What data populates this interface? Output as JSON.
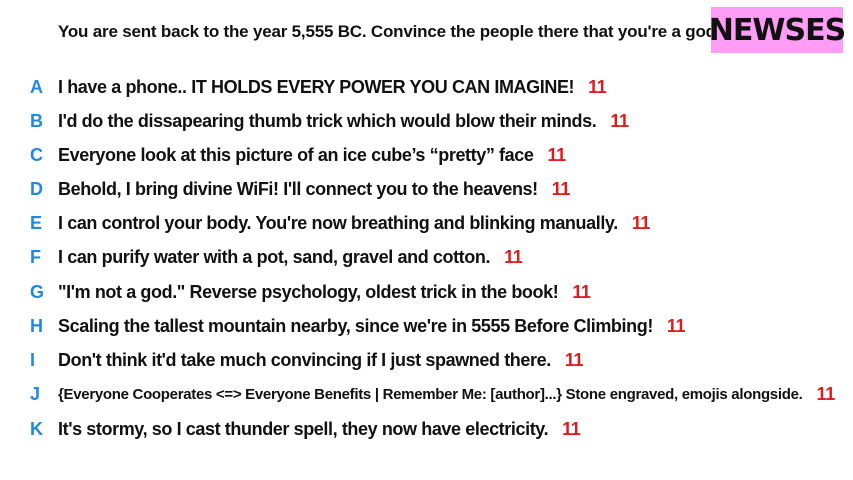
{
  "prompt": "You are sent back to the year 5,555 BC. Convince the people there that you're a god.",
  "brand": "NEWSES",
  "colors": {
    "letter": "#1f88e5",
    "votes": "#e01b1b",
    "brand_bg": "#ff9cf5"
  },
  "answers": [
    {
      "letter": "A",
      "text": "I have a phone.. IT HOLDS EVERY POWER YOU CAN IMAGINE!",
      "votes": "11"
    },
    {
      "letter": "B",
      "text": "I'd do the dissapearing thumb trick which would blow their minds.",
      "votes": "11"
    },
    {
      "letter": "C",
      "text": "Everyone look at this picture of an ice cube’s “pretty” face",
      "votes": "11"
    },
    {
      "letter": "D",
      "text": "Behold, I bring divine WiFi! I'll connect you to the heavens!",
      "votes": "11"
    },
    {
      "letter": "E",
      "text": "I can control your body. You're now breathing and blinking manually.",
      "votes": "11"
    },
    {
      "letter": "F",
      "text": "I can purify water with a pot, sand, gravel and cotton.",
      "votes": "11"
    },
    {
      "letter": "G",
      "text": "\"I'm not a god.\" Reverse psychology, oldest trick in the book!",
      "votes": "11"
    },
    {
      "letter": "H",
      "text": "Scaling the tallest mountain nearby, since we're in 5555 Before Climbing!",
      "votes": "11"
    },
    {
      "letter": "I",
      "text": "Don't think it'd take much convincing if I just spawned there.",
      "votes": "11"
    },
    {
      "letter": "J",
      "text": "{Everyone Cooperates <=> Everyone Benefits | Remember Me: [author]...} Stone engraved, emojis alongside.",
      "votes": "11"
    },
    {
      "letter": "K",
      "text": "It's stormy, so I cast thunder spell, they now have electricity.",
      "votes": "11"
    }
  ]
}
